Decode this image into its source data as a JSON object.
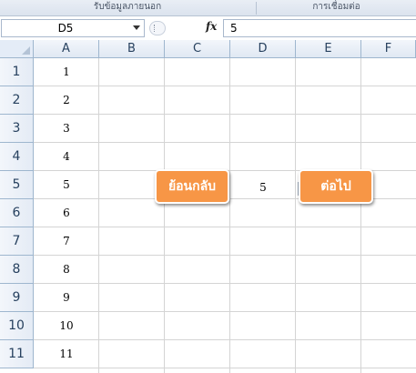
{
  "ribbon": {
    "groups": [
      "รับข้อมูลภายนอก",
      "การเชื่อมต่อ"
    ]
  },
  "formula_bar": {
    "name_box": "D5",
    "fx_label": "fx",
    "content": "5"
  },
  "sheet": {
    "columns": [
      "A",
      "B",
      "C",
      "D",
      "E",
      "F"
    ],
    "rows": [
      "1",
      "2",
      "3",
      "4",
      "5",
      "6",
      "7",
      "8",
      "9",
      "10",
      "11"
    ],
    "column_a_values": [
      "1",
      "2",
      "3",
      "4",
      "5",
      "6",
      "7",
      "8",
      "9",
      "10",
      "11"
    ],
    "selected_cell": "D5",
    "d5_value": "5"
  },
  "buttons": {
    "back_label": "ย้อนกลับ",
    "next_label": "ต่อไป"
  },
  "colors": {
    "button_orange": "#f79646",
    "header_blue": "#e4ecf7",
    "gridline": "#d4d4d4"
  }
}
